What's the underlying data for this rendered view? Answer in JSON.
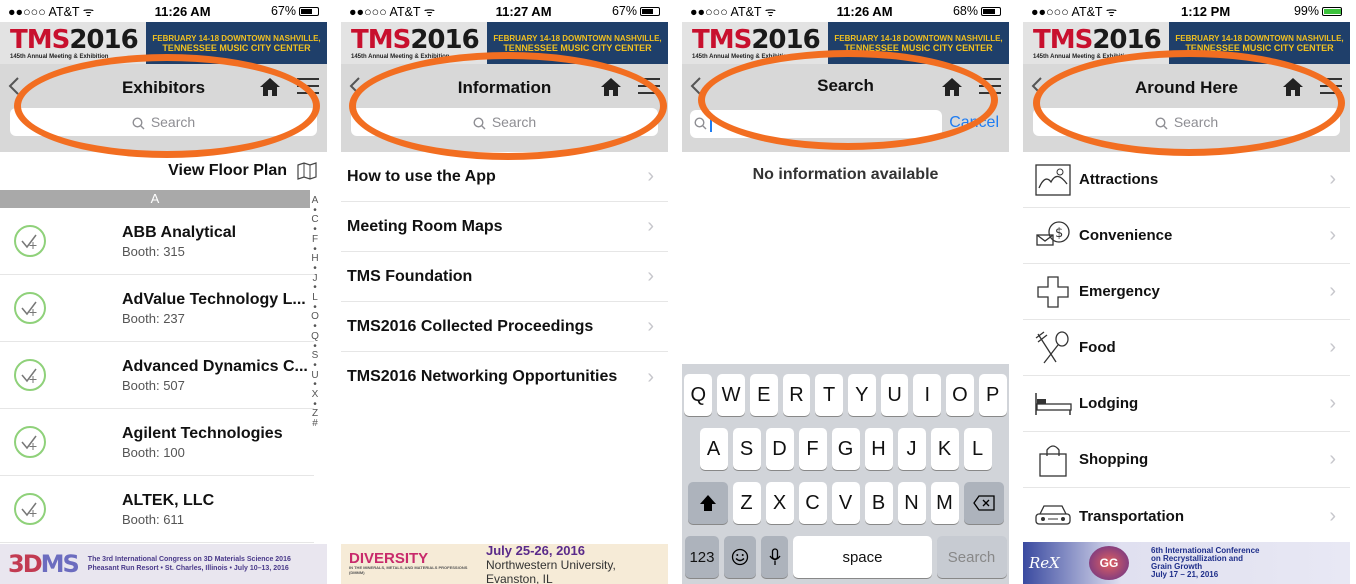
{
  "accent": "#f26e21",
  "screens": [
    {
      "status": {
        "carrier": "●●○○○ AT&T ᯤ",
        "time": "11:26 AM",
        "battery": "67%"
      },
      "banner": {
        "logo": "TMS2016",
        "logo_tm": "TMS",
        "logo_yr": "2016",
        "subtitle": "145th Annual Meeting & Exhibition",
        "line1": "FEBRUARY 14-18 DOWNTOWN NASHVILLE,",
        "line2": "TENNESSEE MUSIC CITY CENTER"
      },
      "title": "Exhibitors",
      "search_placeholder": "Search",
      "floor_plan": "View Floor Plan",
      "section": "A",
      "exhibitors": [
        {
          "name": "ABB Analytical",
          "booth": "Booth: 315"
        },
        {
          "name": "AdValue Technology L...",
          "booth": "Booth: 237"
        },
        {
          "name": "Advanced Dynamics C...",
          "booth": "Booth: 507"
        },
        {
          "name": "Agilent Technologies",
          "booth": "Booth: 100"
        },
        {
          "name": "ALTEK, LLC",
          "booth": "Booth: 611"
        }
      ],
      "index": [
        "A",
        "•",
        "C",
        "•",
        "F",
        "•",
        "H",
        "•",
        "J",
        "•",
        "L",
        "•",
        "O",
        "•",
        "Q",
        "•",
        "S",
        "•",
        "U",
        "•",
        "X",
        "•",
        "Z",
        "#"
      ],
      "ad": {
        "logo_a": "3D",
        "logo_b": "MS",
        "line1": "The 3rd International Congress on 3D Materials Science 2016",
        "line2": "Pheasant Run Resort • St. Charles, Illinois • July 10–13, 2016"
      }
    },
    {
      "status": {
        "carrier": "●●○○○ AT&T ᯤ",
        "time": "11:27 AM",
        "battery": "67%"
      },
      "title": "Information",
      "search_placeholder": "Search",
      "items": [
        "How to use the App",
        "Meeting Room Maps",
        "TMS Foundation",
        "TMS2016 Collected Proceedings",
        "TMS2016 Networking Opportunities"
      ],
      "ad": {
        "logo": "DIVERSITY",
        "logo_sub": "IN THE MINERALS, METALS, AND MATERIALS PROFESSIONS (DMMM)",
        "date": "July 25-26, 2016",
        "place": "Northwestern University, Evanston, IL"
      }
    },
    {
      "status": {
        "carrier": "●●○○○ AT&T ᯤ",
        "time": "11:26 AM",
        "battery": "68%"
      },
      "title": "Search",
      "cancel": "Cancel",
      "message": "No information available",
      "keyboard": {
        "row1": [
          "Q",
          "W",
          "E",
          "R",
          "T",
          "Y",
          "U",
          "I",
          "O",
          "P"
        ],
        "row2": [
          "A",
          "S",
          "D",
          "F",
          "G",
          "H",
          "J",
          "K",
          "L"
        ],
        "row3": [
          "Z",
          "X",
          "C",
          "V",
          "B",
          "N",
          "M"
        ],
        "numbers": "123",
        "space": "space",
        "search": "Search"
      }
    },
    {
      "status": {
        "carrier": "●●○○○ AT&T ᯤ",
        "time": "1:12 PM",
        "battery": "99%"
      },
      "title": "Around Here",
      "search_placeholder": "Search",
      "categories": [
        "Attractions",
        "Convenience",
        "Emergency",
        "Food",
        "Lodging",
        "Shopping",
        "Transportation"
      ],
      "ad": {
        "logo_a": "ReX",
        "logo_b": "GG",
        "line1": "6th International Conference",
        "line2": "on Recrystallization and",
        "line3": "Grain Growth",
        "line4": "July 17 – 21, 2016"
      }
    }
  ]
}
